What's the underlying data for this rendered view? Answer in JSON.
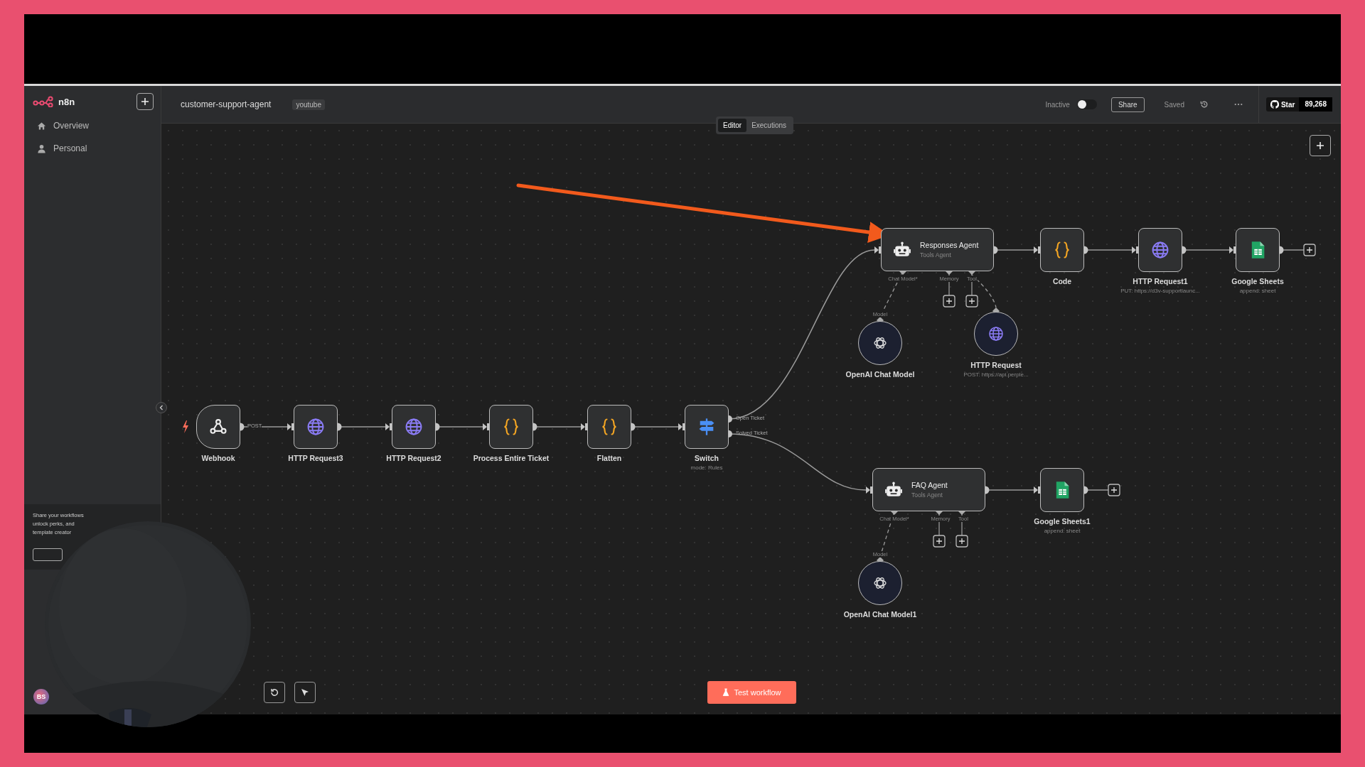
{
  "brand": "n8n",
  "sidebar": {
    "items": [
      {
        "label": "Overview",
        "kind": "home",
        "selected": false
      },
      {
        "label": "Personal",
        "kind": "user",
        "selected": false
      }
    ],
    "promo_lines": [
      "Share your workflows",
      "unlock perks, and",
      "template creator"
    ],
    "avatar": "BS"
  },
  "header": {
    "workflow_name": "customer-support-agent",
    "tags": [
      "youtube"
    ],
    "active_label": "Inactive",
    "active": false,
    "share": "Share",
    "save_status": "Saved",
    "star": "Star",
    "star_count": "89,268"
  },
  "view_tabs": [
    {
      "label": "Editor",
      "selected": true
    },
    {
      "label": "Executions",
      "selected": false
    }
  ],
  "nodes": [
    {
      "kind": "agent",
      "name": "Responses Agent",
      "subtitle": "Tools Agent",
      "ports": [
        "Chat Model*",
        "Memory",
        "Tool"
      ]
    },
    {
      "kind": "code",
      "name": "Code"
    },
    {
      "kind": "http",
      "name": "HTTP Request1",
      "subtitle": "PUT: https://d3v-supportlaunc..."
    },
    {
      "kind": "sheets",
      "name": "Google Sheets",
      "subtitle": "append: sheet"
    },
    {
      "kind": "chat_model",
      "name": "OpenAI Chat Model",
      "port": "Model"
    },
    {
      "kind": "http_tool",
      "name": "HTTP Request",
      "subtitle": "POST: https://api.perple..."
    },
    {
      "kind": "trigger",
      "name": "Webhook",
      "output_label": "POST"
    },
    {
      "kind": "http",
      "name": "HTTP Request3"
    },
    {
      "kind": "http",
      "name": "HTTP Request2"
    },
    {
      "kind": "code",
      "name": "Process Entire Ticket"
    },
    {
      "kind": "code",
      "name": "Flatten"
    },
    {
      "kind": "switch",
      "name": "Switch",
      "subtitle": "mode: Rules",
      "outputs": [
        "Open Ticket",
        "Solved Ticket"
      ]
    },
    {
      "kind": "agent",
      "name": "FAQ Agent",
      "subtitle": "Tools Agent",
      "ports": [
        "Chat Model*",
        "Memory",
        "Tool"
      ]
    },
    {
      "kind": "sheets",
      "name": "Google Sheets1",
      "subtitle": "append: sheet"
    },
    {
      "kind": "chat_model",
      "name": "OpenAI Chat Model1",
      "port": "Model"
    }
  ],
  "test_button": "Test workflow"
}
